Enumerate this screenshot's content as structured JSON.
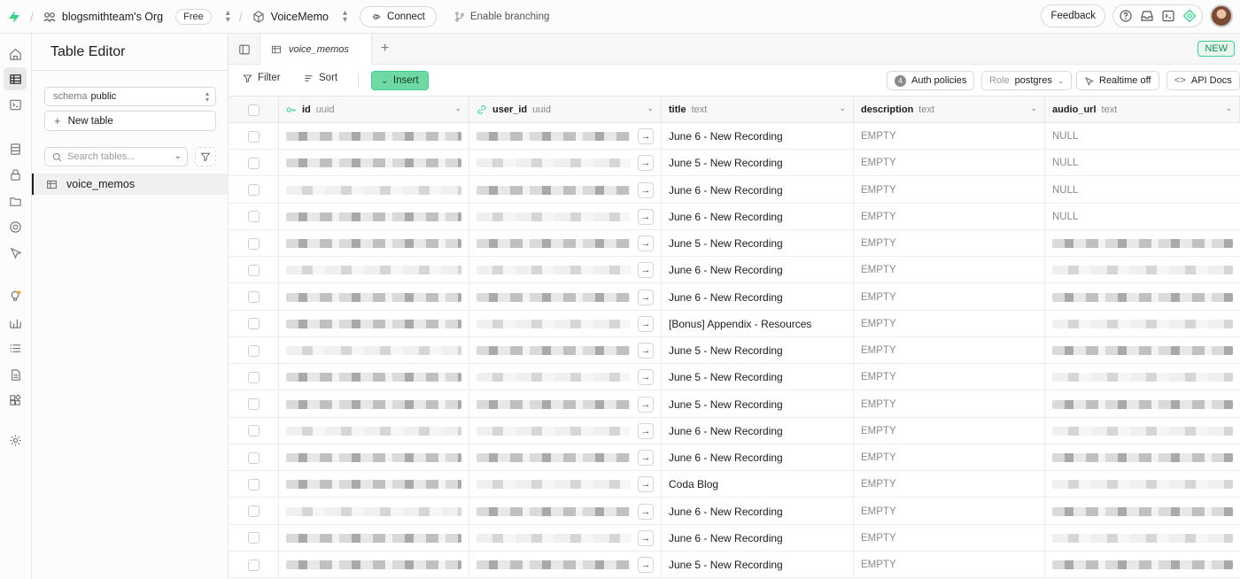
{
  "topbar": {
    "org": "blogsmithteam's Org",
    "plan": "Free",
    "project": "VoiceMemo",
    "connect": "Connect",
    "branching": "Enable branching",
    "feedback": "Feedback"
  },
  "sidebar": {
    "title": "Table Editor",
    "schema_label": "schema",
    "schema_value": "public",
    "new_table": "New table",
    "search_placeholder": "Search tables...",
    "tables": [
      "voice_memos"
    ]
  },
  "tabs": {
    "active": "voice_memos",
    "new_badge": "NEW"
  },
  "toolbar": {
    "filter": "Filter",
    "sort": "Sort",
    "insert": "Insert",
    "auth_policies_count": "4",
    "auth_policies": "Auth policies",
    "role_label": "Role",
    "role_value": "postgres",
    "realtime": "Realtime off",
    "api_docs": "API Docs"
  },
  "columns": [
    {
      "name": "id",
      "type": "uuid"
    },
    {
      "name": "user_id",
      "type": "uuid"
    },
    {
      "name": "title",
      "type": "text"
    },
    {
      "name": "description",
      "type": "text"
    },
    {
      "name": "audio_url",
      "type": "text"
    }
  ],
  "rows": [
    {
      "title": "June 6 - New Recording",
      "description": "EMPTY",
      "audio_url": "NULL"
    },
    {
      "title": "June 5 - New Recording",
      "description": "EMPTY",
      "audio_url": "NULL"
    },
    {
      "title": "June 6 - New Recording",
      "description": "EMPTY",
      "audio_url": "NULL"
    },
    {
      "title": "June 6 - New Recording",
      "description": "EMPTY",
      "audio_url": "NULL"
    },
    {
      "title": "June 5 - New Recording",
      "description": "EMPTY",
      "audio_url": ""
    },
    {
      "title": "June 6 - New Recording",
      "description": "EMPTY",
      "audio_url": ""
    },
    {
      "title": "June 6 - New Recording",
      "description": "EMPTY",
      "audio_url": ""
    },
    {
      "title": "[Bonus] Appendix - Resources",
      "description": "EMPTY",
      "audio_url": ""
    },
    {
      "title": "June 5 - New Recording",
      "description": "EMPTY",
      "audio_url": ""
    },
    {
      "title": "June 5 - New Recording",
      "description": "EMPTY",
      "audio_url": ""
    },
    {
      "title": "June 5 - New Recording",
      "description": "EMPTY",
      "audio_url": ""
    },
    {
      "title": "June 6 - New Recording",
      "description": "EMPTY",
      "audio_url": ""
    },
    {
      "title": "June 6 - New Recording",
      "description": "EMPTY",
      "audio_url": ""
    },
    {
      "title": "Coda Blog",
      "description": "EMPTY",
      "audio_url": ""
    },
    {
      "title": "June 6 - New Recording",
      "description": "EMPTY",
      "audio_url": ""
    },
    {
      "title": "June 6 - New Recording",
      "description": "EMPTY",
      "audio_url": ""
    },
    {
      "title": "June 5 - New Recording",
      "description": "EMPTY",
      "audio_url": ""
    }
  ]
}
